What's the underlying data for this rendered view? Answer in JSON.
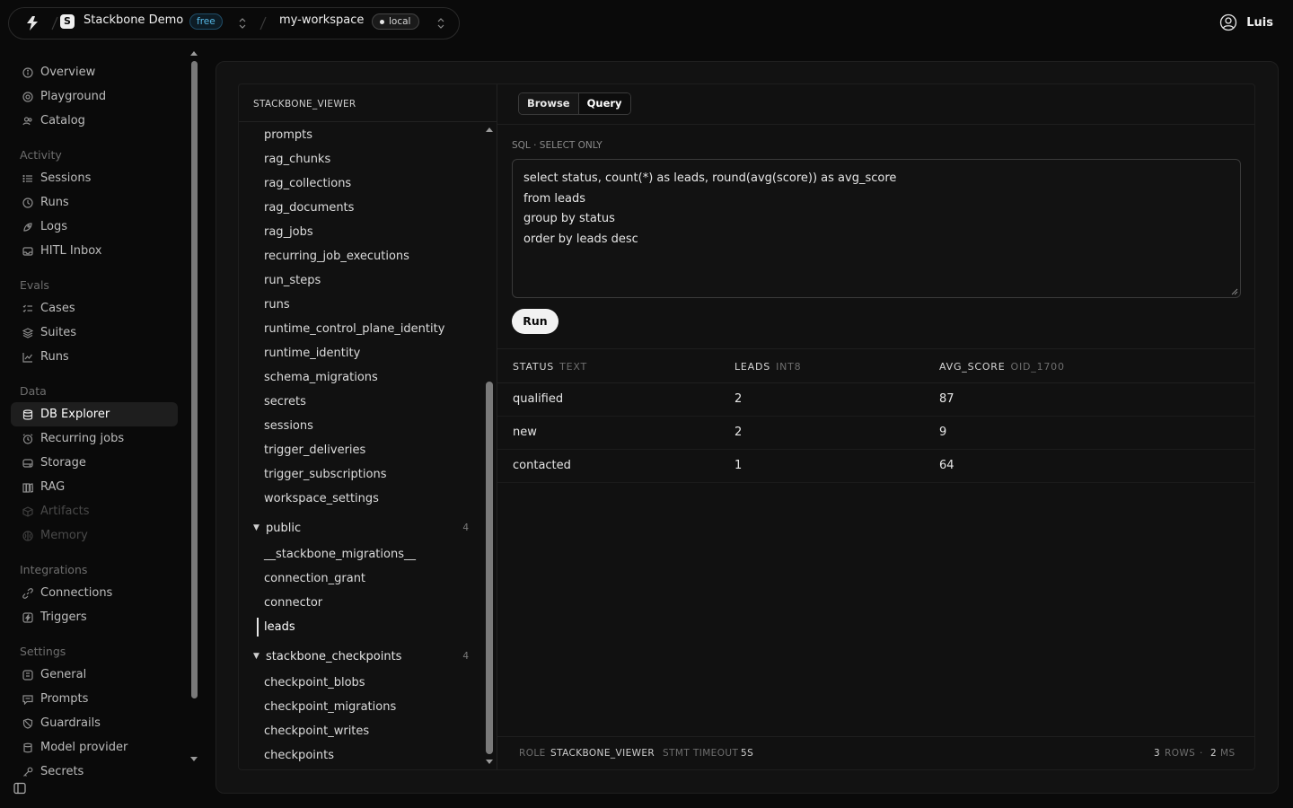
{
  "topbar": {
    "org_avatar_letter": "S",
    "org_name": "Stackbone Demo",
    "plan_badge": "free",
    "workspace_name": "my-workspace",
    "env_badge": "local",
    "user_name": "Luis"
  },
  "sidebar": {
    "top_items": [
      {
        "label": "Overview",
        "icon": "info-circle-icon"
      },
      {
        "label": "Playground",
        "icon": "target-icon"
      },
      {
        "label": "Catalog",
        "icon": "users-icon"
      }
    ],
    "groups": [
      {
        "title": "Activity",
        "items": [
          {
            "label": "Sessions",
            "icon": "list-icon"
          },
          {
            "label": "Runs",
            "icon": "clock-icon"
          },
          {
            "label": "Logs",
            "icon": "rocket-icon"
          },
          {
            "label": "HITL Inbox",
            "icon": "inbox-icon"
          }
        ]
      },
      {
        "title": "Evals",
        "items": [
          {
            "label": "Cases",
            "icon": "checklist-icon"
          },
          {
            "label": "Suites",
            "icon": "stack-icon"
          },
          {
            "label": "Runs",
            "icon": "chart-icon"
          }
        ]
      },
      {
        "title": "Data",
        "items": [
          {
            "label": "DB Explorer",
            "icon": "database-icon",
            "active": true
          },
          {
            "label": "Recurring jobs",
            "icon": "alarm-icon"
          },
          {
            "label": "Storage",
            "icon": "disk-icon"
          },
          {
            "label": "RAG",
            "icon": "books-icon"
          },
          {
            "label": "Artifacts",
            "icon": "box-icon",
            "disabled": true
          },
          {
            "label": "Memory",
            "icon": "brain-icon",
            "disabled": true
          }
        ]
      },
      {
        "title": "Integrations",
        "items": [
          {
            "label": "Connections",
            "icon": "link-icon"
          },
          {
            "label": "Triggers",
            "icon": "bolt-icon"
          }
        ]
      },
      {
        "title": "Settings",
        "items": [
          {
            "label": "General",
            "icon": "sliders-icon"
          },
          {
            "label": "Prompts",
            "icon": "chat-icon"
          },
          {
            "label": "Guardrails",
            "icon": "shield-icon"
          },
          {
            "label": "Model provider",
            "icon": "cube-icon"
          },
          {
            "label": "Secrets",
            "icon": "key-icon"
          }
        ]
      }
    ]
  },
  "explorer": {
    "role_header": "STACKBONE_VIEWER",
    "tables_before": [
      "prompts",
      "rag_chunks",
      "rag_collections",
      "rag_documents",
      "rag_jobs",
      "recurring_job_executions",
      "run_steps",
      "runs",
      "runtime_control_plane_identity",
      "runtime_identity",
      "schema_migrations",
      "secrets",
      "sessions",
      "trigger_deliveries",
      "trigger_subscriptions",
      "workspace_settings"
    ],
    "schemas": [
      {
        "name": "public",
        "count": "4",
        "tables": [
          "__stackbone_migrations__",
          "connection_grant",
          "connector",
          "leads"
        ],
        "selected": "leads"
      },
      {
        "name": "stackbone_checkpoints",
        "count": "4",
        "tables": [
          "checkpoint_blobs",
          "checkpoint_migrations",
          "checkpoint_writes",
          "checkpoints"
        ],
        "selected": ""
      }
    ]
  },
  "query": {
    "tabs": [
      "Browse",
      "Query"
    ],
    "active_tab": "Query",
    "sql_label": "SQL · SELECT ONLY",
    "sql_lines": [
      "select status, count(*) as leads, round(avg(score)) as avg_score",
      "from leads",
      "group by status",
      "order by leads desc"
    ],
    "run_label": "Run"
  },
  "results": {
    "columns": [
      {
        "name": "STATUS",
        "type": "TEXT"
      },
      {
        "name": "LEADS",
        "type": "INT8"
      },
      {
        "name": "AVG_SCORE",
        "type": "OID_1700"
      }
    ],
    "rows": [
      [
        "qualified",
        "2",
        "87"
      ],
      [
        "new",
        "2",
        "9"
      ],
      [
        "contacted",
        "1",
        "64"
      ]
    ]
  },
  "footer": {
    "role_label": "ROLE",
    "role_value": "STACKBONE_VIEWER",
    "timeout_label": "STMT TIMEOUT",
    "timeout_value": "5S",
    "rows_value": "3",
    "rows_label": "ROWS",
    "ms_value": "2",
    "ms_label": "MS"
  }
}
